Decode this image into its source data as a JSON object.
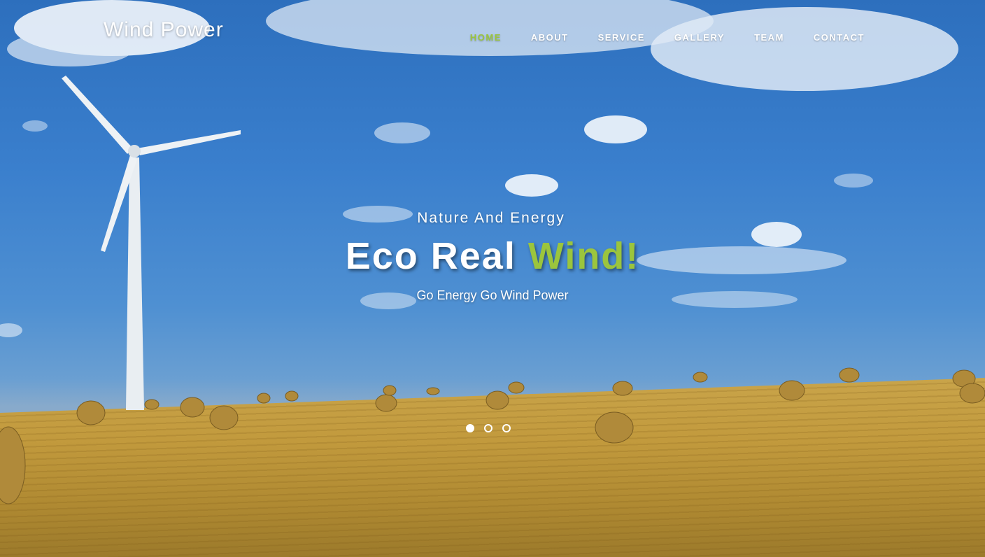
{
  "header": {
    "logo": "Wind Power",
    "nav": [
      {
        "label": "HOME",
        "active": true
      },
      {
        "label": "ABOUT",
        "active": false
      },
      {
        "label": "SERVICE",
        "active": false
      },
      {
        "label": "GALLERY",
        "active": false
      },
      {
        "label": "TEAM",
        "active": false
      },
      {
        "label": "CONTACT",
        "active": false
      }
    ]
  },
  "hero": {
    "kicker": "Nature And Energy",
    "headline_main": "Eco Real ",
    "headline_accent": "Wind!",
    "tagline": "Go Energy Go Wind Power"
  },
  "slider": {
    "slide_count": 3,
    "active_index": 0
  },
  "colors": {
    "accent": "#9bc53d",
    "text": "#ffffff",
    "sky": "#3a7fcd",
    "field": "#c29a3d"
  }
}
